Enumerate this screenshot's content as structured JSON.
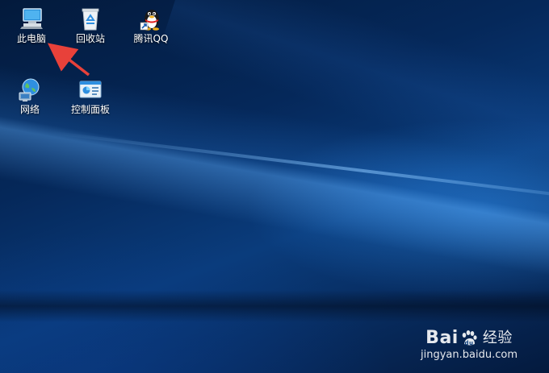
{
  "desktop": {
    "icons": [
      {
        "id": "computer",
        "label": "此电脑",
        "icon": "computer-icon"
      },
      {
        "id": "recycle",
        "label": "回收站",
        "icon": "recycle-bin-icon"
      },
      {
        "id": "qq",
        "label": "腾讯QQ",
        "icon": "qq-penguin-icon"
      },
      {
        "id": "network",
        "label": "网络",
        "icon": "network-globe-icon"
      },
      {
        "id": "control",
        "label": "控制面板",
        "icon": "control-panel-icon"
      }
    ],
    "annotation": {
      "type": "arrow",
      "color": "#e8413a",
      "points_to": "此电脑"
    }
  },
  "watermark": {
    "brand_left": "Bai",
    "brand_right": "经验",
    "url": "jingyan.baidu.com"
  },
  "colors": {
    "background_dark": "#031a3c",
    "background_mid": "#0a3c7c",
    "light_beam": "#5aaaf9"
  }
}
